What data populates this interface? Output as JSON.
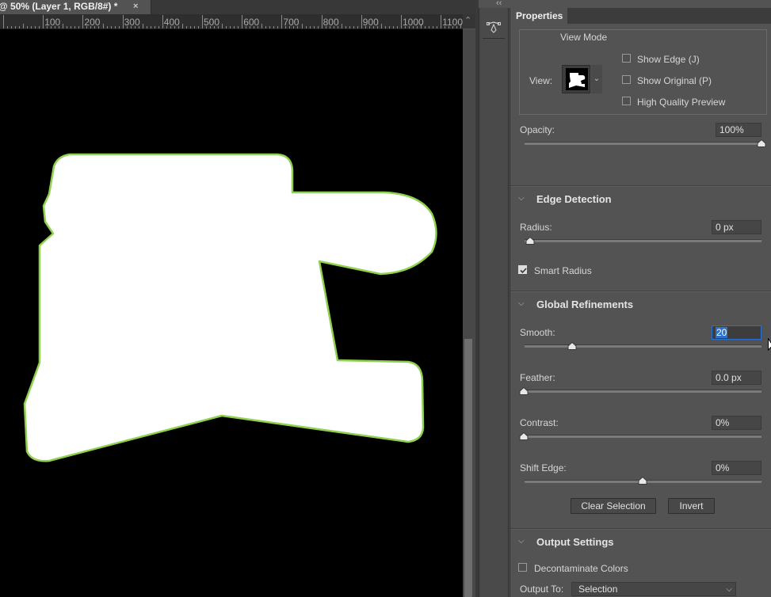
{
  "document": {
    "tab_title": "@ 50% (Layer 1, RGB/8#) *",
    "close_glyph": "×",
    "ruler_labels": [
      "100",
      "200",
      "300",
      "400",
      "500",
      "600",
      "700",
      "800",
      "900",
      "1000",
      "1100"
    ],
    "ruler_corner_glyph": "⌃"
  },
  "panel": {
    "collapse_glyph": "‹‹",
    "tab_label": "Properties",
    "view_mode": {
      "group_label": "View Mode",
      "view_label": "View:",
      "view_dropdown_glyph": "⌄",
      "options": [
        {
          "label": "Show Edge (J)",
          "checked": false
        },
        {
          "label": "Show Original (P)",
          "checked": false
        },
        {
          "label": "High Quality Preview",
          "checked": false
        }
      ]
    },
    "opacity": {
      "label": "Opacity:",
      "value": "100%",
      "level": 1.0
    },
    "edge_detection": {
      "header": "Edge Detection",
      "radius": {
        "label": "Radius:",
        "value": "0 px",
        "level": 0.0
      },
      "smart_radius": {
        "label": "Smart Radius",
        "checked": true
      }
    },
    "global_refinements": {
      "header": "Global Refinements",
      "smooth": {
        "label": "Smooth:",
        "value": "20",
        "level": 0.2
      },
      "feather": {
        "label": "Feather:",
        "value": "0.0 px",
        "level": 0.0
      },
      "contrast": {
        "label": "Contrast:",
        "value": "0%",
        "level": 0.0
      },
      "shift_edge": {
        "label": "Shift Edge:",
        "value": "0%",
        "level": 0.5
      },
      "clear_selection_label": "Clear Selection",
      "invert_label": "Invert"
    },
    "output_settings": {
      "header": "Output Settings",
      "decontaminate": {
        "label": "Decontaminate Colors",
        "checked": false
      },
      "output_to_label": "Output To:",
      "output_to_value": "Selection"
    },
    "chevron_glyph": "⌵"
  },
  "colors": {
    "edge_highlight": "#8fd14f",
    "selection_fill": "#ffffff",
    "canvas_background": "#000000",
    "accent_blue": "#2f71c6"
  }
}
